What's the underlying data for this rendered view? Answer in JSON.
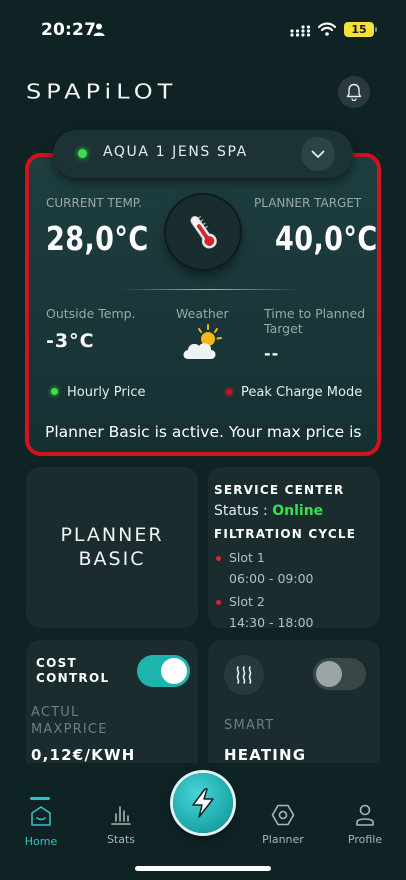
{
  "status_bar": {
    "time": "20:27",
    "battery": "15"
  },
  "header": {
    "logo": "SPAPiLOT"
  },
  "spa_selector": {
    "name": "AQUA 1 JENS SPA"
  },
  "main_card": {
    "current_label": "CURRENT TEMP.",
    "current_value": "28,0°C",
    "target_label": "PLANNER TARGET",
    "target_value": "40,0°C",
    "outside_label": "Outside Temp.",
    "outside_value": "-3°C",
    "weather_label": "Weather",
    "planned_label": "Time to Planned Target",
    "planned_value": "--",
    "hourly_price_label": "Hourly Price",
    "peak_charge_label": "Peak Charge Mode",
    "ticker": "Planner Basic is active. Your max price is"
  },
  "planner_tile": {
    "line1": "PLANNER",
    "line2": "BASIC"
  },
  "service_tile": {
    "title": "SERVICE CENTER",
    "status_prefix": "Status : ",
    "status_value": "Online",
    "filtration_title": "FILTRATION CYCLE",
    "slots": [
      {
        "label": "Slot 1",
        "time": "06:00 - 09:00"
      },
      {
        "label": "Slot 2",
        "time": "14:30 - 18:00"
      }
    ]
  },
  "cost_tile": {
    "title_line1": "COST",
    "title_line2": "CONTROL",
    "toggle_on": true,
    "sub_line1": "ACTUL",
    "sub_line2": "MAXPRICE",
    "value": "0,12€/KWH"
  },
  "heat_tile": {
    "toggle_on": false,
    "sub": "SMART",
    "value": "HEATING"
  },
  "nav": {
    "home": "Home",
    "stats": "Stats",
    "planner": "Planner",
    "profile": "Profile"
  },
  "colors": {
    "background": "#0f2325",
    "accent": "#1fb3ae",
    "alert_border": "#d4111c",
    "online_green": "#3be04a"
  },
  "icons": [
    "person-icon",
    "signal-icon",
    "wifi-icon",
    "bell-icon",
    "chevron-down-icon",
    "thermometer-icon",
    "weather-partly-cloudy-icon",
    "heat-waves-icon",
    "home-icon",
    "stats-icon",
    "bolt-icon",
    "planner-icon",
    "profile-icon"
  ]
}
